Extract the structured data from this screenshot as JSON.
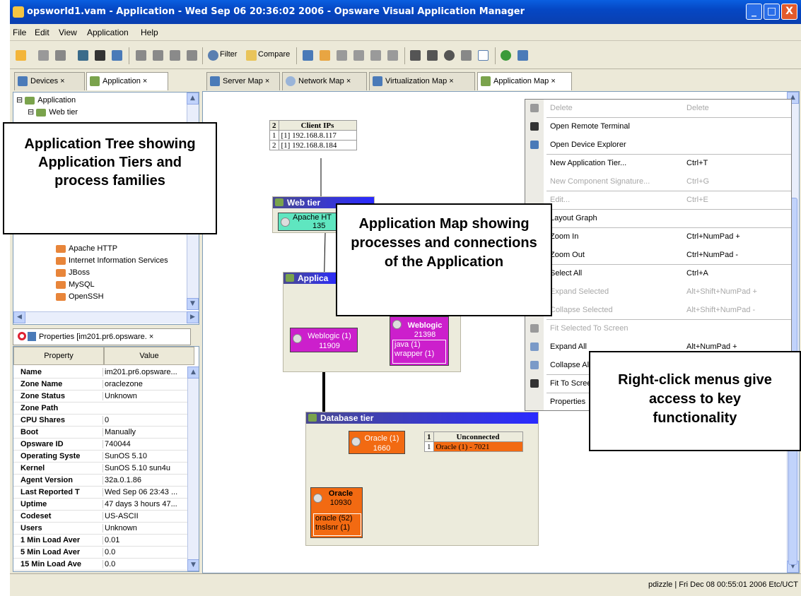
{
  "window": {
    "title": "opsworld1.vam - Application - Wed Sep 06 20:36:02 2006 - Opsware Visual Application Manager",
    "min": "_",
    "max": "□",
    "close": "X"
  },
  "menu": [
    "File",
    "Edit",
    "View",
    "Application",
    "Help"
  ],
  "toolbar": {
    "filter": "Filter",
    "compare": "Compare"
  },
  "left_tabs": [
    "Devices",
    "Application"
  ],
  "right_tabs": [
    "Server Map",
    "Network Map",
    "Virtualization Map",
    "Application Map"
  ],
  "tree": {
    "root": "Application",
    "web": "Web tier",
    "procs": [
      "Apache HTTP",
      "Internet Information Services",
      "JBoss",
      "MySQL",
      "OpenSSH"
    ]
  },
  "properties": {
    "tab": "Properties [im201.pr6.opsware.",
    "col_property": "Property",
    "col_value": "Value",
    "rows": [
      [
        "Name",
        "im201.pr6.opsware..."
      ],
      [
        "Zone Name",
        "oraclezone"
      ],
      [
        "Zone Status",
        "Unknown"
      ],
      [
        "Zone Path",
        ""
      ],
      [
        "CPU Shares",
        "0"
      ],
      [
        "Boot",
        "Manually"
      ],
      [
        "Opsware ID",
        "740044"
      ],
      [
        "Operating Syste",
        "SunOS 5.10"
      ],
      [
        "Kernel",
        "SunOS 5.10 sun4u"
      ],
      [
        "Agent Version",
        "32a.0.1.86"
      ],
      [
        "Last Reported T",
        "Wed Sep 06 23:43 ..."
      ],
      [
        "Uptime",
        "47 days 3 hours 47..."
      ],
      [
        "Codeset",
        "US-ASCII"
      ],
      [
        "Users",
        "Unknown"
      ],
      [
        "1 Min Load Aver",
        "0.01"
      ],
      [
        "5 Min Load Aver",
        "0.0"
      ],
      [
        "15 Min Load Ave",
        "0.0"
      ]
    ]
  },
  "map": {
    "client": {
      "count": "2",
      "header": "Client IPs",
      "rows": [
        [
          "1",
          "[1] 192.168.8.117"
        ],
        [
          "2",
          "[1] 192.168.8.184"
        ]
      ]
    },
    "web_tier": "Web tier",
    "apache": {
      "name": "Apache HT",
      "pid": "135"
    },
    "app_tier": "Applica",
    "weblogic1": {
      "name": "Weblogic (1)",
      "pid": "11909"
    },
    "weblogic2": {
      "name": "Weblogic",
      "pid": "21398",
      "subs": [
        "java (1)",
        "wrapper (1)"
      ]
    },
    "db_tier": "Database tier",
    "oracle1": {
      "name": "Oracle (1)",
      "pid": "1660"
    },
    "unconnected": {
      "count": "1",
      "header": "Unconnected",
      "row": [
        "1",
        "Oracle (1) - 7021"
      ]
    },
    "oracle2": {
      "name": "Oracle",
      "pid": "10930",
      "subs": [
        "oracle (52)",
        "tnslsnr (1)"
      ]
    }
  },
  "context_menu": [
    {
      "label": "Delete",
      "shortcut": "Delete",
      "disabled": true
    },
    {
      "label": "Open Remote Terminal",
      "shortcut": "",
      "disabled": false
    },
    {
      "label": "Open Device Explorer",
      "shortcut": "",
      "disabled": false
    },
    {
      "label": "New Application Tier...",
      "shortcut": "Ctrl+T",
      "disabled": false
    },
    {
      "label": "New Component Signature...",
      "shortcut": "Ctrl+G",
      "disabled": true
    },
    {
      "label": "Edit...",
      "shortcut": "Ctrl+E",
      "disabled": true
    },
    {
      "label": "Layout Graph",
      "shortcut": "",
      "disabled": false
    },
    {
      "label": "Zoom In",
      "shortcut": "Ctrl+NumPad +",
      "disabled": false
    },
    {
      "label": "Zoom Out",
      "shortcut": "Ctrl+NumPad -",
      "disabled": false
    },
    {
      "label": "Select All",
      "shortcut": "Ctrl+A",
      "disabled": false
    },
    {
      "label": "Expand Selected",
      "shortcut": "Alt+Shift+NumPad +",
      "disabled": true
    },
    {
      "label": "Collapse Selected",
      "shortcut": "Alt+Shift+NumPad -",
      "disabled": true
    },
    {
      "label": "Fit Selected To Screen",
      "shortcut": "",
      "disabled": true
    },
    {
      "label": "Expand All",
      "shortcut": "Alt+NumPad +",
      "disabled": false
    },
    {
      "label": "Collapse All",
      "shortcut": "",
      "disabled": false
    },
    {
      "label": "Fit To Screen",
      "shortcut": "",
      "disabled": false
    },
    {
      "label": "Properties",
      "shortcut": "",
      "disabled": false
    }
  ],
  "callouts": {
    "tree": "Application Tree showing Application Tiers and process families",
    "map": "Application Map showing processes and connections of the Application",
    "menu": "Right-click menus give access to key functionality"
  },
  "status": "pdizzle | Fri Dec 08 00:55:01 2006 Etc/UCT"
}
